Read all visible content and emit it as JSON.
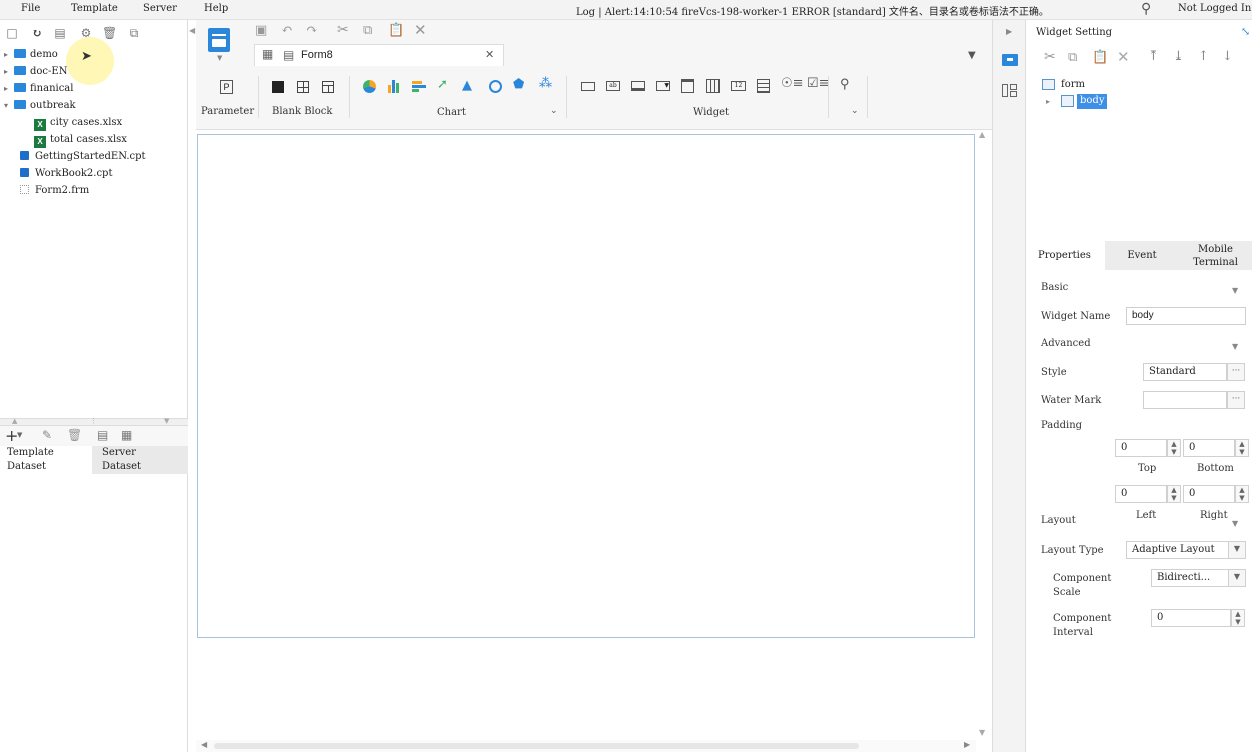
{
  "menu": {
    "file": "File",
    "template": "Template",
    "server": "Server",
    "help": "Help"
  },
  "status": {
    "log": "Log | Alert:14:10:54 fireVcs-198-worker-1 ERROR [standard] 文件名、目录名或卷标语法不正确。",
    "login": "Not Logged In"
  },
  "tree": {
    "items": [
      {
        "label": "demo"
      },
      {
        "label": "doc-EN"
      },
      {
        "label": "finanical"
      },
      {
        "label": "outbreak"
      },
      {
        "label": "city cases.xlsx"
      },
      {
        "label": "total cases.xlsx"
      },
      {
        "label": "GettingStartedEN.cpt"
      },
      {
        "label": "WorkBook2.cpt"
      },
      {
        "label": "Form2.frm"
      }
    ]
  },
  "datasets": {
    "template": "Template\nDataset",
    "template_l1": "Template",
    "template_l2": "Dataset",
    "server_l1": "Server",
    "server_l2": "Dataset"
  },
  "editor": {
    "tab_label": "Form8",
    "groups": {
      "parameter": "Parameter",
      "blank_block": "Blank Block",
      "chart": "Chart",
      "widget": "Widget"
    }
  },
  "right": {
    "title": "Widget Setting",
    "tree_root": "form",
    "tree_child": "body",
    "tabs": {
      "properties": "Properties",
      "event": "Event",
      "mobile_l1": "Mobile",
      "mobile_l2": "Terminal"
    },
    "basic": "Basic",
    "widget_name_label": "Widget Name",
    "widget_name_value": "body",
    "advanced": "Advanced",
    "style_label": "Style",
    "style_value": "Standard",
    "watermark_label": "Water Mark",
    "padding_label": "Padding",
    "pad_top": "0",
    "pad_bottom": "0",
    "pad_left": "0",
    "pad_right": "0",
    "top": "Top",
    "bottom": "Bottom",
    "left": "Left",
    "right": "Right",
    "layout": "Layout",
    "layout_type_label": "Layout Type",
    "layout_type_value": "Adaptive Layout",
    "scale_l1": "Component",
    "scale_l2": "Scale",
    "scale_value": "Bidirecti...",
    "interval_l1": "Component",
    "interval_l2": "Interval",
    "interval_value": "0"
  },
  "colors": {
    "accent": "#2b87d9",
    "canvas_border": "#a9c2de",
    "selected": "#3d8fe8"
  }
}
